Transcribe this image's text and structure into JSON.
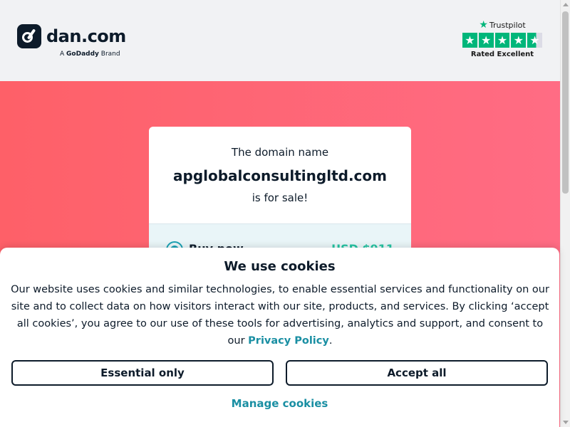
{
  "header": {
    "logo_text": "dan.com",
    "logo_sub_prefix": "A",
    "logo_sub_brand": "GoDaddy",
    "logo_sub_suffix": "Brand",
    "trustpilot_name": "Trustpilot",
    "trustpilot_rating": "Rated Excellent"
  },
  "card": {
    "line1": "The domain name",
    "domain": "apglobalconsultingltd.com",
    "line3": "is for sale!",
    "buy_label": "Buy now",
    "buy_price": "USD $911"
  },
  "cookie": {
    "title": "We use cookies",
    "body": "Our website uses cookies and similar technologies, to enable essential services and functionality on our site and to collect data on how visitors interact with our site, products, and services. By clicking ‘accept all cookies’, you agree to our use of these tools for advertising, analytics and support, and consent to our",
    "policy_link": "Privacy Policy",
    "body_end": ".",
    "essential_button": "Essential only",
    "accept_button": "Accept all",
    "manage_link": "Manage cookies"
  },
  "colors": {
    "brand_dark": "#0d1b2a",
    "hero_start": "#fe6068",
    "hero_end": "#ff6c84",
    "link": "#1a8fa3",
    "trustpilot_green": "#00b67a"
  },
  "icons": [
    "dan-logo-icon",
    "trustpilot-star-icon",
    "radio-icon"
  ]
}
